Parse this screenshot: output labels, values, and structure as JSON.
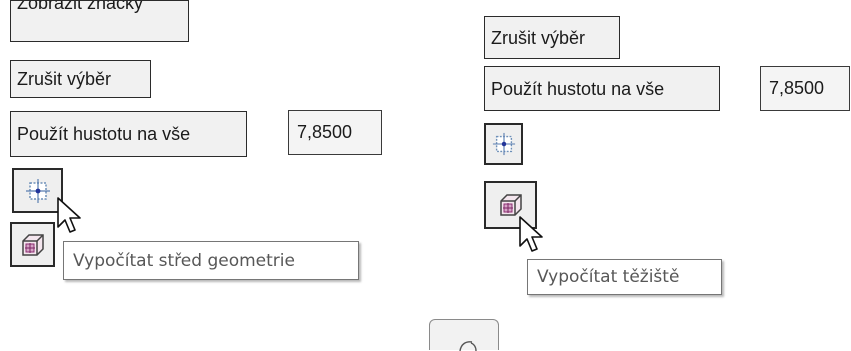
{
  "left_panel": {
    "show_marks_label": "Zobrazit značky",
    "clear_selection_label": "Zrušit výběr",
    "apply_density_label": "Použít hustotu na vše",
    "density_value": "7,8500",
    "center_icon": "crosshair-center-icon",
    "mass_icon": "cube-center-icon",
    "tooltip": "Vypočítat střed geometrie"
  },
  "right_panel": {
    "clear_selection_label": "Zrušit výběr",
    "apply_density_label": "Použít hustotu na vše",
    "density_value": "7,8500",
    "center_icon": "crosshair-center-icon",
    "mass_icon": "cube-center-icon",
    "tooltip": "Vypočítat těžiště"
  }
}
